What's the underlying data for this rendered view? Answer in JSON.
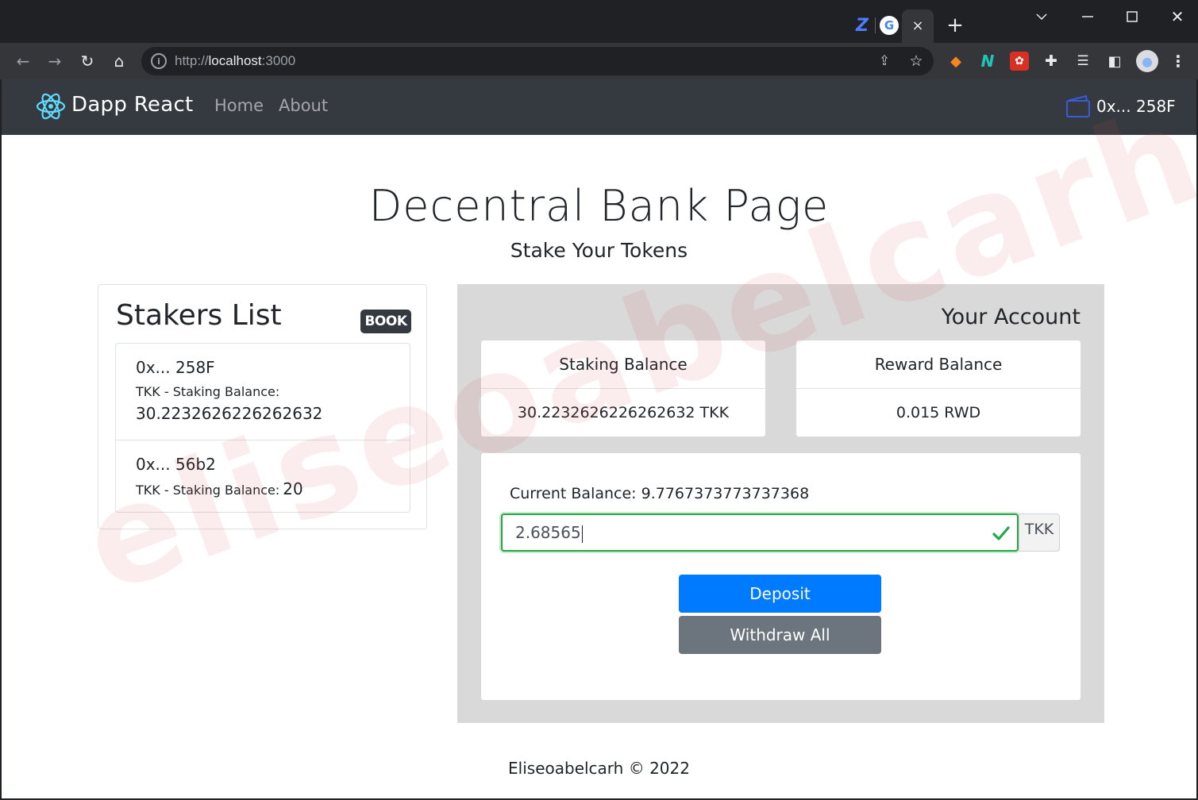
{
  "browser": {
    "tab_close_glyph": "×",
    "url_scheme": "http://",
    "url_host": "localhost",
    "url_port": ":3000"
  },
  "navbar": {
    "brand": "Dapp React",
    "links": [
      "Home",
      "About"
    ],
    "wallet_address": "0x... 258F",
    "brand_color": "#61dafb"
  },
  "page": {
    "title": "Decentral Bank Page",
    "subtitle": "Stake Your Tokens",
    "footer": "Eliseoabelcarh © 2022",
    "watermark": "eliseoabelcarh"
  },
  "stakers": {
    "title": "Stakers List",
    "badge": "BOOK",
    "items": [
      {
        "address": "0x... 258F",
        "label": "TKK - Staking Balance:",
        "value": "30.2232626226262632"
      },
      {
        "address": "0x... 56b2",
        "label": "TKK - Staking Balance:",
        "value": "20"
      }
    ]
  },
  "account": {
    "title": "Your Account",
    "staking_balance_label": "Staking Balance",
    "staking_balance_value": "30.2232626226262632 TKK",
    "reward_balance_label": "Reward Balance",
    "reward_balance_value": "0.015 RWD",
    "current_balance": "Current Balance: 9.7767373773737368",
    "amount_value": "2.68565",
    "amount_unit": "TKK",
    "deposit_label": "Deposit",
    "withdraw_label": "Withdraw All"
  },
  "colors": {
    "navbar_bg": "#343a40",
    "deposit_btn": "#007bff",
    "withdraw_btn": "#6c757d",
    "valid_green": "#28a745",
    "panel_bg": "#d9d9d9"
  }
}
